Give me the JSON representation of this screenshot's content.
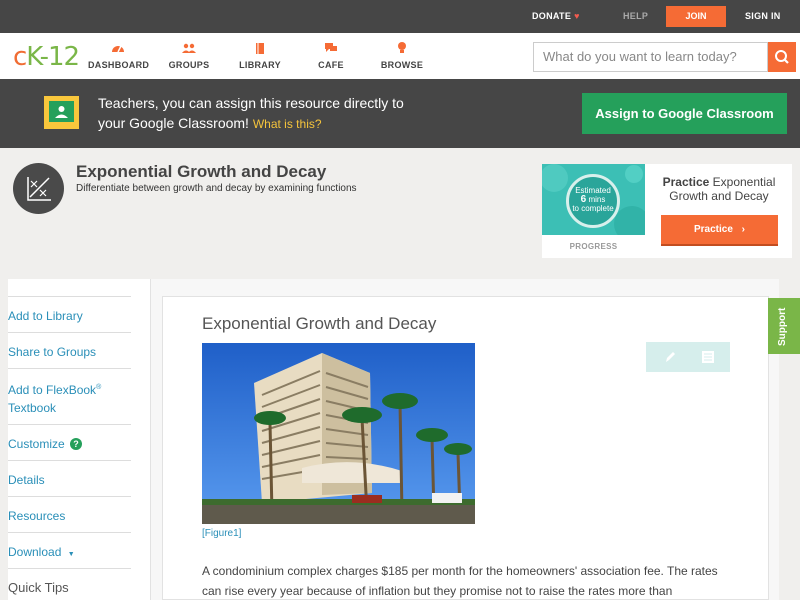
{
  "topbar": {
    "donate": "DONATE",
    "help": "HELP",
    "join": "JOIN",
    "sign_in": "SIGN IN"
  },
  "nav": {
    "logo_c": "c",
    "logo_k": "K",
    "logo_dash": "-",
    "logo_num": "12",
    "items": [
      {
        "label": "DASHBOARD",
        "icon": "dashboard-icon"
      },
      {
        "label": "GROUPS",
        "icon": "groups-icon"
      },
      {
        "label": "LIBRARY",
        "icon": "library-icon"
      },
      {
        "label": "CAFE",
        "icon": "cafe-icon"
      },
      {
        "label": "BROWSE",
        "icon": "browse-icon"
      }
    ],
    "search_placeholder": "What do you want to learn today?"
  },
  "banner": {
    "line1": "Teachers, you can assign this resource directly to",
    "line2": "your Google Classroom!",
    "what": "What is this?",
    "assign": "Assign to Google Classroom"
  },
  "concept": {
    "title": "Exponential Growth and Decay",
    "subtitle": "Differentiate between growth and decay by examining functions"
  },
  "practice": {
    "estimated": "Estimated",
    "mins_number": "6",
    "mins_word": "mins",
    "to_complete": "to complete",
    "progress": "PROGRESS",
    "bold": "Practice",
    "topic_1": "Exponential",
    "topic_2": "Growth and Decay",
    "button": "Practice"
  },
  "sidebar": {
    "items": [
      "Add to Library",
      "Share to Groups",
      "Add to FlexBook",
      "Textbook",
      "Customize",
      "Details",
      "Resources",
      "Download",
      "Quick Tips"
    ],
    "registered": "®",
    "customize_badge": "?",
    "download_caret": "▼"
  },
  "article": {
    "title": "Exponential Growth and Decay",
    "caption": "[Figure1]",
    "paragraph": "A condominium complex charges $185 per month for the homeowners' association fee. The rates can rise every year because of inflation but they promise not to raise the rates more than"
  },
  "support": "Support",
  "colors": {
    "accent_orange": "#f56b35",
    "brand_green": "#7ab648",
    "classroom_green": "#25a05b",
    "link_blue": "#2a8fb8",
    "dark_bar": "#464646"
  }
}
